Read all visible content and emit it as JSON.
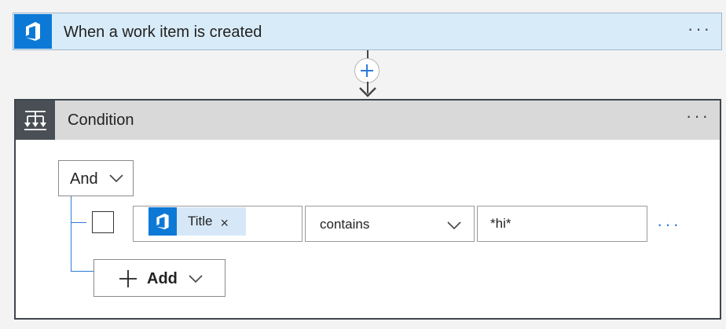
{
  "trigger": {
    "title": "When a work item is created",
    "icon": "azure-devops-icon",
    "more_label": "···"
  },
  "connector": {
    "add_icon": "plus-icon"
  },
  "condition": {
    "title": "Condition",
    "icon": "condition-icon",
    "more_label": "···",
    "group_operator": "And",
    "rows": [
      {
        "token_label": "Title",
        "token_icon": "azure-devops-icon",
        "token_remove": "×",
        "operator": "contains",
        "value": "*hi*",
        "more_label": "···"
      }
    ],
    "add_label": "Add"
  },
  "colors": {
    "trigger_bg": "#d8ebf8",
    "devops_blue": "#0d79d6",
    "condition_header_bg": "#d9d9d9",
    "condition_icon_bg": "#4a4f55",
    "link_blue": "#2b7bd6"
  }
}
